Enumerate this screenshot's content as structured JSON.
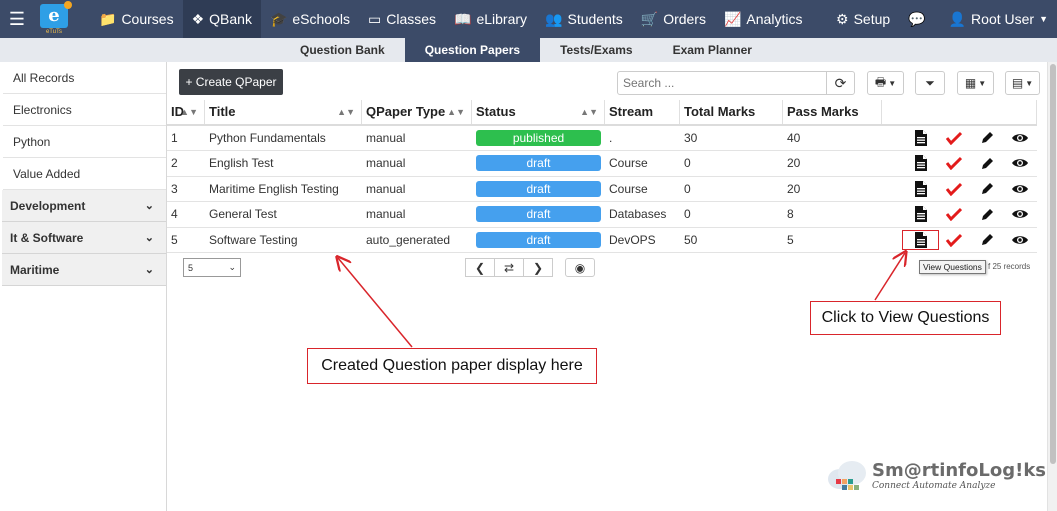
{
  "nav": {
    "logo_text": "e",
    "logo_sub": "eTuTs",
    "items": [
      {
        "label": "Courses",
        "icon": "folder-icon",
        "active": false
      },
      {
        "label": "QBank",
        "icon": "puzzle-icon",
        "active": true
      },
      {
        "label": "eSchools",
        "icon": "graduation-cap-icon",
        "active": false
      },
      {
        "label": "Classes",
        "icon": "monitor-icon",
        "active": false
      },
      {
        "label": "eLibrary",
        "icon": "book-icon",
        "active": false
      },
      {
        "label": "Students",
        "icon": "users-icon",
        "active": false
      },
      {
        "label": "Orders",
        "icon": "cart-icon",
        "active": false
      },
      {
        "label": "Analytics",
        "icon": "line-chart-icon",
        "active": false
      }
    ],
    "setup_label": "Setup",
    "user_label": "Root User"
  },
  "subnav": {
    "tabs": [
      "Question Bank",
      "Question Papers",
      "Tests/Exams",
      "Exam Planner"
    ],
    "active_index": 1
  },
  "sidebar": {
    "records": [
      "All Records",
      "Electronics",
      "Python",
      "Value Added"
    ],
    "categories": [
      "Development",
      "It & Software",
      "Maritime"
    ]
  },
  "toolbar": {
    "create_label": "+ Create QPaper",
    "search_placeholder": "Search ..."
  },
  "table": {
    "columns": [
      "ID",
      "Title",
      "QPaper Type",
      "Status",
      "Stream",
      "Total Marks",
      "Pass Marks"
    ],
    "rows": [
      {
        "id": "1",
        "title": "Python Fundamentals",
        "type": "manual",
        "status": "published",
        "stream": ".",
        "total": "30",
        "pass": "40"
      },
      {
        "id": "2",
        "title": "English Test",
        "type": "manual",
        "status": "draft",
        "stream": "Course",
        "total": "0",
        "pass": "20"
      },
      {
        "id": "3",
        "title": "Maritime English Testing",
        "type": "manual",
        "status": "draft",
        "stream": "Course",
        "total": "0",
        "pass": "20"
      },
      {
        "id": "4",
        "title": "General Test",
        "type": "manual",
        "status": "draft",
        "stream": "Databases",
        "total": "0",
        "pass": "8"
      },
      {
        "id": "5",
        "title": "Software Testing",
        "type": "auto_generated",
        "status": "draft",
        "stream": "DevOPS",
        "total": "50",
        "pass": "5"
      }
    ]
  },
  "status_colors": {
    "published": "#2dbf4e",
    "draft": "#45a0ee"
  },
  "pager": {
    "page_size": "5",
    "records_text": "f 25 records"
  },
  "tooltip": "View Questions",
  "callouts": {
    "view": "Click to View Questions",
    "created": "Created Question paper display here"
  },
  "brand": {
    "name": "Sm@rtinfoLog!ks",
    "tagline": "Connect Automate Analyze"
  }
}
